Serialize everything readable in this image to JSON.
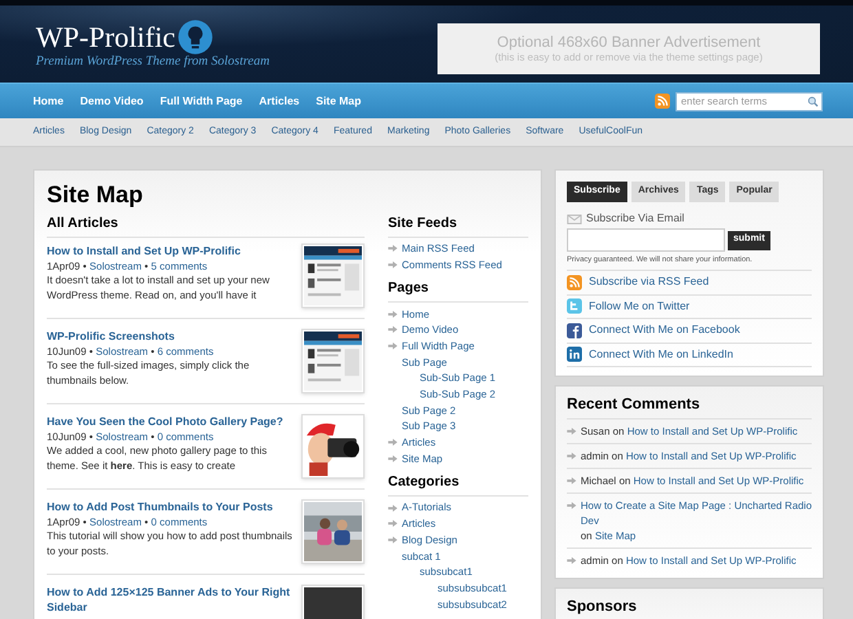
{
  "site": {
    "title": "WP-Prolific",
    "tagline": "Premium WordPress Theme from Solostream"
  },
  "banner": {
    "title": "Optional 468x60 Banner Advertisement",
    "subtitle": "(this is easy to add or remove via the theme settings page)"
  },
  "nav": [
    "Home",
    "Demo Video",
    "Full Width Page",
    "Articles",
    "Site Map"
  ],
  "search": {
    "placeholder": "enter search terms"
  },
  "subnav": [
    "Articles",
    "Blog Design",
    "Category 2",
    "Category 3",
    "Category 4",
    "Featured",
    "Marketing",
    "Photo Galleries",
    "Software",
    "UsefulCoolFun"
  ],
  "page_title": "Site Map",
  "articles_heading": "All Articles",
  "articles": [
    {
      "title": "How to Install and Set Up WP-Prolific",
      "meta": [
        {
          "text": "1Apr09",
          "kind": "plain"
        },
        {
          "text": "•",
          "kind": "plain"
        },
        {
          "text": "Solostream",
          "kind": "link"
        },
        {
          "text": "•",
          "kind": "plain"
        },
        {
          "text": "5 comments",
          "kind": "link"
        }
      ],
      "excerpt": "It doesn't take a lot to install and set up your new WordPress theme. Read on, and you'll have it"
    },
    {
      "title": "WP-Prolific Screenshots",
      "meta": [
        {
          "text": "10Jun09",
          "kind": "plain"
        },
        {
          "text": "•",
          "kind": "plain"
        },
        {
          "text": "Solostream",
          "kind": "link"
        },
        {
          "text": "•",
          "kind": "plain"
        },
        {
          "text": "6 comments",
          "kind": "link"
        }
      ],
      "excerpt": "To see the full-sized images, simply click the thumbnails below."
    },
    {
      "title": "Have You Seen the Cool Photo Gallery Page?",
      "meta": [
        {
          "text": "10Jun09",
          "kind": "plain"
        },
        {
          "text": "•",
          "kind": "plain"
        },
        {
          "text": "Solostream",
          "kind": "link"
        },
        {
          "text": "•",
          "kind": "plain"
        },
        {
          "text": "0 comments",
          "kind": "link"
        }
      ],
      "excerpt": "We added a cool, new photo gallery page to this theme. See it **here**. This is easy to create"
    },
    {
      "title": "How to Add Post Thumbnails to Your Posts",
      "meta": [
        {
          "text": "1Apr09",
          "kind": "plain"
        },
        {
          "text": "•",
          "kind": "plain"
        },
        {
          "text": "Solostream",
          "kind": "link"
        },
        {
          "text": "•",
          "kind": "plain"
        },
        {
          "text": "0 comments",
          "kind": "link"
        }
      ],
      "excerpt": "This tutorial will show you how to add post thumbnails to your posts."
    },
    {
      "title": "How to Add 125×125 Banner Ads to Your Right Sidebar"
    }
  ],
  "sections": [
    {
      "heading": "Site Feeds",
      "items": [
        {
          "label": "Main RSS Feed"
        },
        {
          "label": "Comments RSS Feed"
        }
      ]
    },
    {
      "heading": "Pages",
      "items": [
        {
          "label": "Home"
        },
        {
          "label": "Demo Video"
        },
        {
          "label": "Full Width Page",
          "children": [
            {
              "label": "Sub Page",
              "children": [
                {
                  "label": "Sub-Sub Page 1"
                },
                {
                  "label": "Sub-Sub Page 2"
                }
              ]
            },
            {
              "label": "Sub Page 2"
            },
            {
              "label": "Sub Page 3"
            }
          ]
        },
        {
          "label": "Articles"
        },
        {
          "label": "Site Map"
        }
      ]
    },
    {
      "heading": "Categories",
      "items": [
        {
          "label": "A-Tutorials"
        },
        {
          "label": "Articles"
        },
        {
          "label": "Blog Design",
          "children": [
            {
              "label": "subcat 1",
              "children": [
                {
                  "label": "subsubcat1",
                  "children": [
                    {
                      "label": "subsubsubcat1"
                    },
                    {
                      "label": "subsubsubcat2"
                    }
                  ]
                }
              ]
            }
          ]
        }
      ]
    }
  ],
  "tabs": [
    {
      "label": "Subscribe",
      "selected": true
    },
    {
      "label": "Archives",
      "selected": false
    },
    {
      "label": "Tags",
      "selected": false
    },
    {
      "label": "Popular",
      "selected": false
    }
  ],
  "subscribe": {
    "label": "Subscribe Via Email",
    "button": "submit",
    "privacy": "Privacy guaranteed. We will not share your information."
  },
  "social": [
    {
      "label": "Subscribe via RSS Feed",
      "kind": "rss"
    },
    {
      "label": "Follow Me on Twitter",
      "kind": "twitter"
    },
    {
      "label": "Connect With Me on Facebook",
      "kind": "facebook"
    },
    {
      "label": "Connect With Me on LinkedIn",
      "kind": "linkedin"
    }
  ],
  "recent_comments": {
    "heading": "Recent Comments",
    "items": [
      [
        {
          "text": "Susan",
          "kind": "plain"
        },
        {
          "text": "on",
          "kind": "plain"
        },
        {
          "text": "How to Install and Set Up WP-Prolific",
          "kind": "link"
        }
      ],
      [
        {
          "text": "admin",
          "kind": "plain"
        },
        {
          "text": "on",
          "kind": "plain"
        },
        {
          "text": "How to Install and Set Up WP-Prolific",
          "kind": "link"
        }
      ],
      [
        {
          "text": "Michael",
          "kind": "plain"
        },
        {
          "text": "on",
          "kind": "plain"
        },
        {
          "text": "How to Install and Set Up WP-Prolific",
          "kind": "link"
        }
      ],
      [
        {
          "text": "How to Create a Site Map Page : Uncharted Radio Dev",
          "kind": "link"
        },
        {
          "text": "on",
          "kind": "plain"
        },
        {
          "text": "Site Map",
          "kind": "link"
        }
      ],
      [
        {
          "text": "admin",
          "kind": "plain"
        },
        {
          "text": "on",
          "kind": "plain"
        },
        {
          "text": "How to Install and Set Up WP-Prolific",
          "kind": "link"
        }
      ]
    ]
  },
  "sponsors": {
    "heading": "Sponsors"
  }
}
